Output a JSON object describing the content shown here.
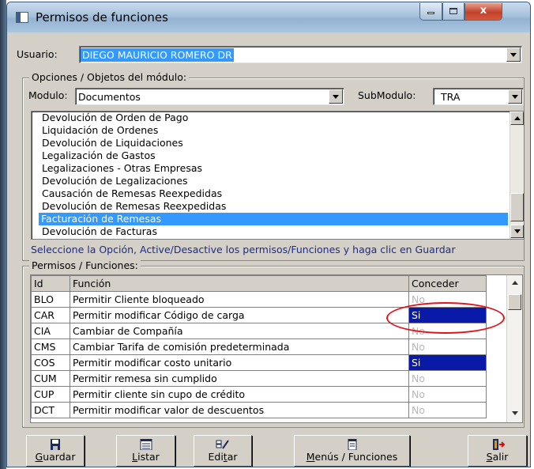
{
  "window": {
    "title": "Permisos de funciones",
    "min_glyph": "",
    "max_glyph": "",
    "close_glyph": "x"
  },
  "usuario": {
    "label": "Usuario:",
    "value": "DIEGO MAURICIO ROMERO DR"
  },
  "opciones": {
    "group_title": "Opciones / Objetos del módulo:",
    "modulo_label": "Modulo:",
    "modulo_value": "Documentos",
    "submodulo_label": "SubModulo:",
    "submodulo_value": "TRA",
    "items": [
      "Devolución de Orden de Pago",
      "Liquidación de Ordenes",
      "Devolución de Liquidaciones",
      "Legalización de Gastos",
      "Legalizaciones - Otras Empresas",
      "Devolución de Legalizaciones",
      "Causación de Remesas Reexpedidas",
      "Devolución de Remesas Reexpedidas",
      "Facturación de Remesas",
      "Devolución de Facturas"
    ],
    "selected_index": 8,
    "hint": "Seleccione la Opción, Active/Desactive los permisos/Funciones y haga clic en Guardar"
  },
  "permisos": {
    "group_title": "Permisos / Funciones:",
    "headers": {
      "id": "Id",
      "funcion": "Función",
      "conceder": "Conceder"
    },
    "rows": [
      {
        "id": "BLO",
        "funcion": "Permitir Cliente bloqueado",
        "conceder": "No"
      },
      {
        "id": "CAR",
        "funcion": "Permitir modificar Código de carga",
        "conceder": "Si"
      },
      {
        "id": "CIA",
        "funcion": "Cambiar de Compañía",
        "conceder": "No"
      },
      {
        "id": "CMS",
        "funcion": "Cambiar Tarifa de comisión predeterminada",
        "conceder": "No"
      },
      {
        "id": "COS",
        "funcion": "Permitir modificar costo unitario",
        "conceder": "Si"
      },
      {
        "id": "CUM",
        "funcion": "Permitir  remesa sin cumplido",
        "conceder": "No"
      },
      {
        "id": "CUP",
        "funcion": "Permitir cliente sin cupo de crédito",
        "conceder": "No"
      },
      {
        "id": "DCT",
        "funcion": "Permitir modificar valor de descuentos",
        "conceder": "No"
      }
    ]
  },
  "buttons": {
    "guardar_a": "G",
    "guardar_b": "uardar",
    "listar_a": "L",
    "listar_b": "istar",
    "editar_a": "Edi",
    "editar_u": "t",
    "editar_b": "ar",
    "menus_a": "M",
    "menus_b": "enús / Funciones",
    "salir_a": "S",
    "salir_b": "alir"
  },
  "colors": {
    "selection": "#3399ff",
    "granted": "#0a1aa8",
    "annotation": "#e0151c"
  }
}
